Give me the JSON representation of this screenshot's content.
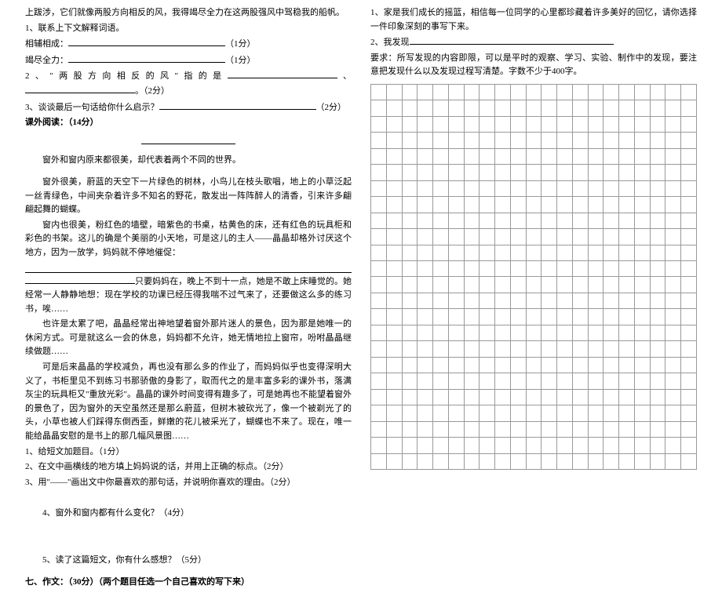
{
  "left": {
    "p1": "上跋涉，它们就像两股方向相反的风，我得竭尽全力在这两股强风中驾稳我的船帆。",
    "q1_intro": "1、联系上下文解释词语。",
    "q1a_label": "相辅相成：",
    "q1a_score": "（1分）",
    "q1b_label": "竭尽全力：",
    "q1b_score": "（1分）",
    "q2_label": "2、\"两股方向相反的风\"指的是",
    "q2_score": "。（2分）",
    "q3_label": "3、谈谈最后一句话给你什么启示？",
    "q3_score": "（2分）",
    "section_reading": "课外阅读：（14分）",
    "para1": "窗外和窗内原来都很美，却代表着两个不同的世界。",
    "para2": "窗外很美，蔚蓝的天空下一片绿色的树林，小鸟儿在枝头歌唱，地上的小草泛起一丝青绿色，中间夹杂着许多不知名的野花，散发出一阵阵醉人的清香，引来许多翩翩起舞的蝴蝶。",
    "para3": "窗内也很美，粉红色的墙壁，暗紫色的书桌，枯黄色的床，还有红色的玩具柜和彩色的书架。这儿的确是个美丽的小天地，可是这儿的主人——晶晶却格外讨厌这个地方，因为一放学，妈妈就不停地催促：",
    "para4_suffix": "只要妈妈在，晚上不到十一点，她是不敢上床睡觉的。她经常一人静静地想：现在学校的功课已经压得我喘不过气来了，还要做这么多的练习书，唉……",
    "para5": "也许是太累了吧，晶晶经常出神地望着窗外那片迷人的景色，因为那是她唯一的休闲方式。可是就这么一会的休息，妈妈都不允许，她无情地拉上窗帘，吩咐晶晶继续做题……",
    "para6": "可是后来晶晶的学校减负，再也没有那么多的作业了，而妈妈似乎也变得深明大义了，书柜里见不到练习书那骄傲的身影了，取而代之的是丰富多彩的课外书，落满灰尘的玩具柜又\"重放光彩\"。晶晶的课外时间变得有趣多了，可是她再也不能望着窗外的景色了，因为窗外的天空虽然还是那么蔚蓝，但树木被砍光了，像一个被剃光了的头，小草也被人们踩得东倒西歪，鲜嫩的花儿被采光了，蝴蝶也不来了。现在，唯一能给晶晶安慰的是书上的那几幅风景图……",
    "q_sub1": "1、给短文加题目。（1分）",
    "q_sub2": "2、在文中画横线的地方填上妈妈说的话，并用上正确的标点。（2分）",
    "q_sub3": "3、用\"——\"画出文中你最喜欢的那句话，并说明你喜欢的理由。（2分）",
    "q_sub4": "4、窗外和窗内都有什么变化？（4分）",
    "q_sub5": "5、读了这篇短文，你有什么感想？（5分）",
    "section7_pre": "七、作文：（30分）",
    "section7_note": "（两个题目任选一个自己喜欢的写下来）"
  },
  "right": {
    "prompt1": "1、家是我们成长的摇篮，相信每一位同学的心里都珍藏着许多美好的回忆，请你选择一件印象深刻的事写下来。",
    "prompt2": "2、我发现",
    "prompt_req": "要求：所写发现的内容即限，可以是平时的观察、学习、实验、制作中的发现，要注意把发现什么以及发现过程写清楚。字数不少于400字。"
  }
}
